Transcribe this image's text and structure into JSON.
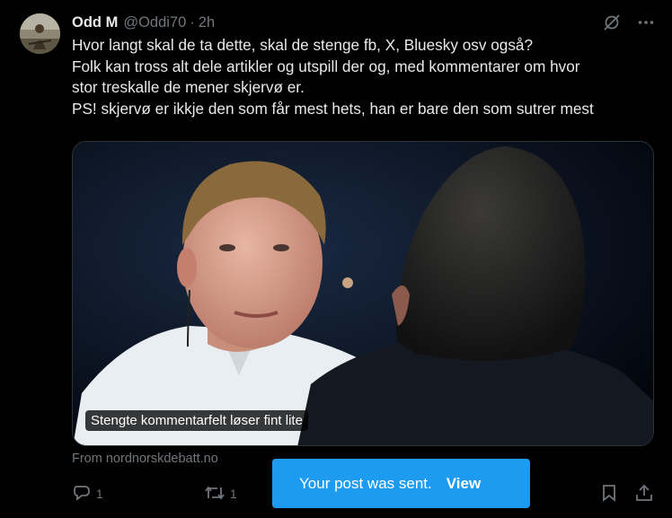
{
  "post": {
    "author_name": "Odd M",
    "author_handle": "@Oddi70",
    "separator": "·",
    "timestamp": "2h",
    "text_lines": [
      "Hvor langt skal de ta dette, skal de stenge fb, X, Bluesky osv også?",
      "Folk kan tross alt dele artikler og utspill der og, med kommentarer om hvor",
      "stor treskalle de mener skjervø er.",
      "PS! skjervø er ikkje den som får mest hets, han er bare den som sutrer mest"
    ]
  },
  "link_card": {
    "caption": "Stengte kommentarfelt løser fint lite",
    "source": "From nordnorskdebatt.no"
  },
  "actions": {
    "reply_count": "1",
    "repost_count": "1"
  },
  "toast": {
    "message": "Your post was sent.",
    "action_label": "View"
  },
  "icons": {
    "grok": "grok-icon",
    "more": "more-icon",
    "reply": "reply-icon",
    "repost": "repost-icon",
    "bookmark": "bookmark-icon",
    "share": "share-icon"
  },
  "colors": {
    "background": "#000000",
    "text": "#e7e9ea",
    "muted": "#71767b",
    "accent": "#1d9bf0"
  }
}
